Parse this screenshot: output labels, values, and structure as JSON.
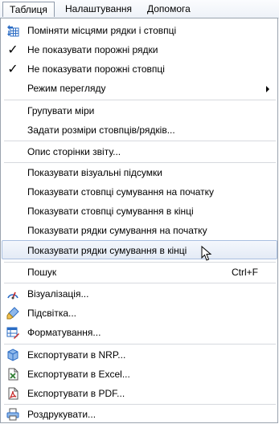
{
  "menubar": {
    "items": [
      {
        "label": "Таблиця"
      },
      {
        "label": "Налаштування"
      },
      {
        "label": "Допомога"
      }
    ]
  },
  "menu": {
    "swap_rows_cols": "Поміняти місцями рядки і стовпці",
    "hide_empty_rows": "Не показувати порожні рядки",
    "hide_empty_cols": "Не показувати порожні стовпці",
    "view_mode": "Режим перегляду",
    "group_measures": "Групувати міри",
    "set_sizes": "Задати розміри стовпців/рядків...",
    "page_desc": "Опис сторінки звіту...",
    "show_visual_totals": "Показувати візуальні підсумки",
    "sum_cols_start": "Показувати стовпці сумування на початку",
    "sum_cols_end": "Показувати стовпці сумування в кінці",
    "sum_rows_start": "Показувати рядки сумування на початку",
    "sum_rows_end": "Показувати рядки сумування в кінці",
    "search": "Пошук",
    "search_shortcut": "Ctrl+F",
    "visualization": "Візуалізація...",
    "highlight": "Підсвітка...",
    "formatting": "Форматування...",
    "export_nrp": "Експортувати в NRP...",
    "export_excel": "Експортувати в Excel...",
    "export_pdf": "Експортувати в PDF...",
    "print": "Роздрукувати..."
  },
  "colors": {
    "accent_blue": "#2b6cc4",
    "hover_bg": "#e4ebf6",
    "excel_green": "#2e7d32",
    "pdf_red": "#c62828"
  }
}
